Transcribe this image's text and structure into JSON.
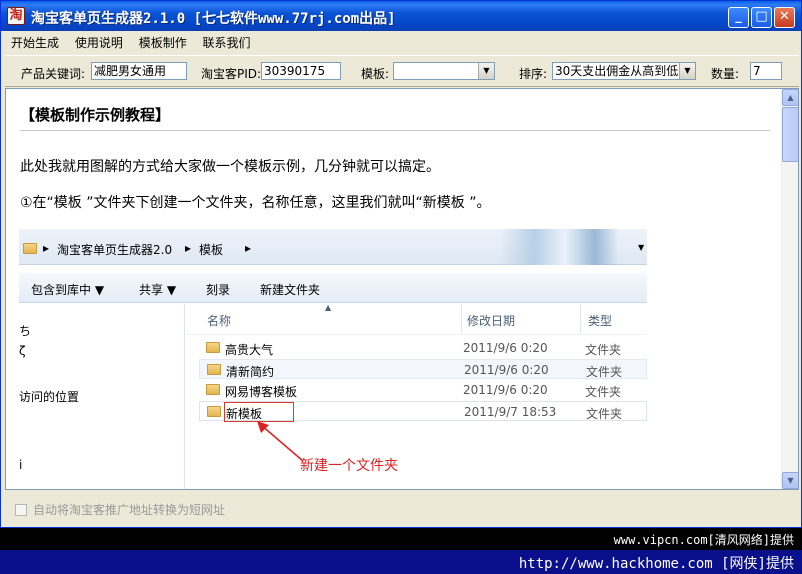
{
  "window": {
    "title": "淘宝客单页生成器2.1.0 [七七软件www.77rj.com出品]",
    "icon_glyph": "淘"
  },
  "title_buttons": {
    "minimize": "_",
    "maximize": "□",
    "close": "✕"
  },
  "menu": [
    "开始生成",
    "使用说明",
    "模板制作",
    "联系我们"
  ],
  "toolbar": {
    "keyword_label": "产品关键词:",
    "keyword_value": "减肥男女通用",
    "pid_label": "淘宝客PID:",
    "pid_value": "30390175",
    "template_label": "模板:",
    "template_value": "",
    "sort_label": "排序:",
    "sort_value": "30天支出佣金从高到低",
    "count_label": "数量:",
    "count_value": "7"
  },
  "doc": {
    "heading": "【模板制作示例教程】",
    "para1": "此处我就用图解的方式给大家做一个模板示例，几分钟就可以搞定。",
    "para2": "①在“模板 ”文件夹下创建一个文件夹，名称任意，这里我们就叫“新模板 ”。"
  },
  "explorer": {
    "breadcrumb": [
      "淘宝客单页生成器2.0",
      "模板"
    ],
    "commands": [
      "包含到库中 ▼",
      "共享 ▼",
      "刻录",
      "新建文件夹"
    ],
    "nav_items": [
      "ち",
      "ζ",
      "访问的位置",
      "i"
    ],
    "columns": {
      "name": "名称",
      "date": "修改日期",
      "type": "类型"
    },
    "files": [
      {
        "name": "高贵大气",
        "date": "2011/9/6 0:20",
        "type": "文件夹"
      },
      {
        "name": "清新简约",
        "date": "2011/9/6 0:20",
        "type": "文件夹"
      },
      {
        "name": "网易博客模板",
        "date": "2011/9/6 0:20",
        "type": "文件夹"
      },
      {
        "name": "新模板",
        "date": "2011/9/7 18:53",
        "type": "文件夹"
      }
    ],
    "annotation": "新建一个文件夹"
  },
  "footer": {
    "checkbox_label": "自动将淘宝客推广地址转换为短网址"
  },
  "watermarks": {
    "line1": "www.vipcn.com[清风网络]提供",
    "line2": "http://www.hackhome.com [网侠]提供"
  },
  "colors": {
    "title_blue": "#0349cc",
    "annotation_red": "#d22222",
    "banner_blue": "#0a0f8c"
  }
}
